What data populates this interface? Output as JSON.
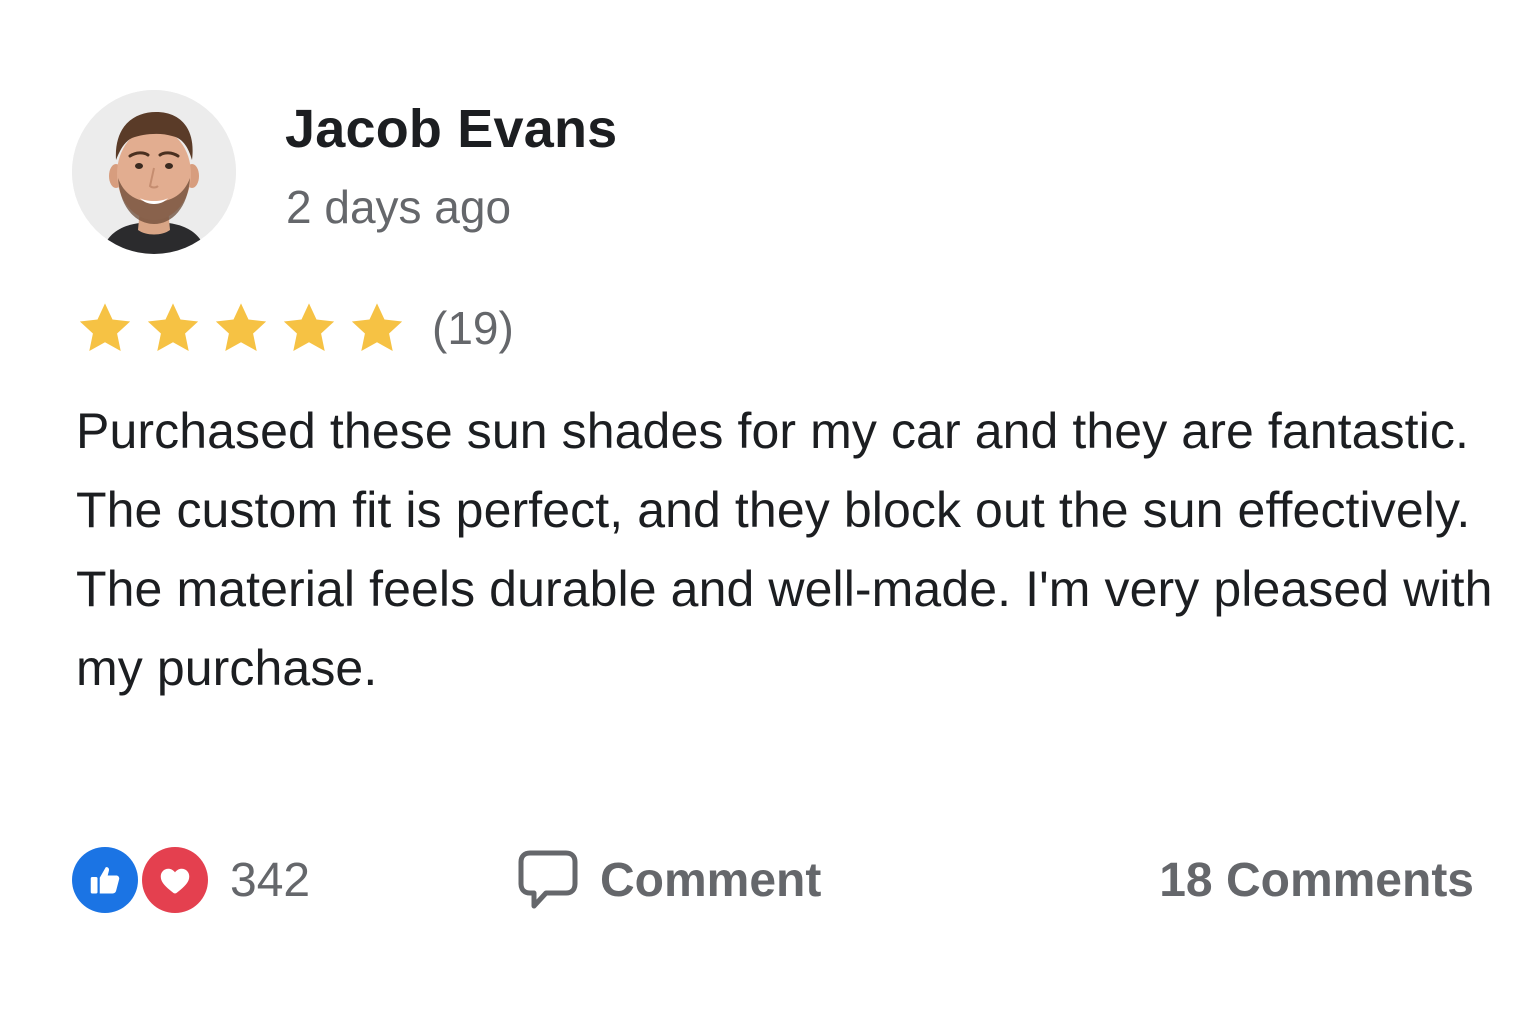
{
  "review": {
    "author": {
      "name": "Jacob Evans",
      "avatar_icon": "user-avatar-photo"
    },
    "timestamp": "2 days ago",
    "rating": {
      "stars": 5,
      "max_stars": 5,
      "count_label": "(19)",
      "star_color": "#F6C244"
    },
    "text": "Purchased these sun shades for my car and they are fantastic. The custom fit is perfect, and they block out the sun effectively. The material feels durable and well-made. I'm very pleased with my purchase."
  },
  "footer": {
    "reactions": {
      "icons": [
        "like-icon",
        "love-icon"
      ],
      "like_color": "#1B74E4",
      "love_color": "#E4404F",
      "count": "342"
    },
    "comment_button": {
      "icon": "comment-bubble-icon",
      "label": "Comment"
    },
    "comments_count": "18 Comments"
  },
  "colors": {
    "primary_text": "#1C1E21",
    "secondary_text": "#65676B",
    "background": "#FFFFFF"
  }
}
